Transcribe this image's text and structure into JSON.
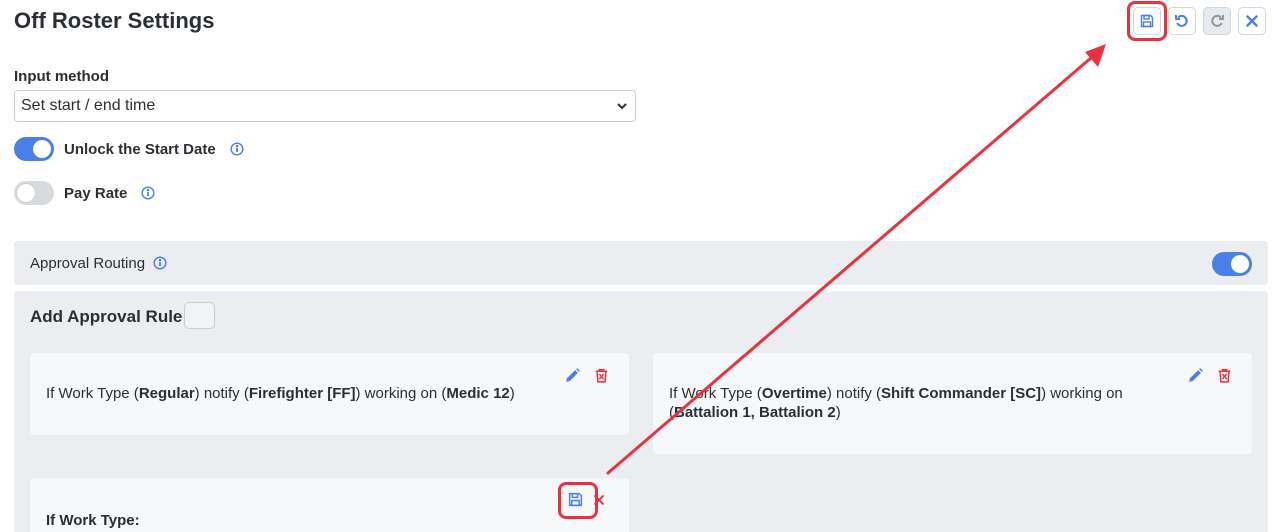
{
  "page": {
    "title": "Off Roster Settings"
  },
  "toolbar": {
    "buttons": [
      {
        "name": "save",
        "icon": "save-icon",
        "highlighted": true
      },
      {
        "name": "undo",
        "icon": "undo-icon"
      },
      {
        "name": "redo",
        "icon": "redo-icon",
        "disabled": true
      },
      {
        "name": "close",
        "icon": "close-icon"
      }
    ]
  },
  "input_method": {
    "label": "Input method",
    "selected": "Set start / end time"
  },
  "toggles": {
    "unlock_start_date": {
      "label": "Unlock the Start Date",
      "on": true
    },
    "pay_rate": {
      "label": "Pay Rate",
      "on": false
    }
  },
  "approval_routing": {
    "label": "Approval Routing",
    "on": true
  },
  "approval_rules": {
    "add_label": "Add Approval Rule",
    "rules": [
      {
        "p1": "If Work Type (",
        "work_type": "Regular",
        "p2": ") notify (",
        "role": "Firefighter [FF]",
        "p3": ") working on (",
        "location": "Medic 12",
        "p4": ")"
      },
      {
        "p1": "If Work Type (",
        "work_type": "Overtime",
        "p2": ") notify (",
        "role": "Shift Commander [SC]",
        "p3": ") working on (",
        "location": "Battalion 1, Battalion 2",
        "p4": ")"
      }
    ],
    "new_rule": {
      "label": "If Work Type:"
    }
  },
  "colors": {
    "accent": "#4a7ee8",
    "danger": "#e8323f",
    "panel": "#ecedf0"
  }
}
